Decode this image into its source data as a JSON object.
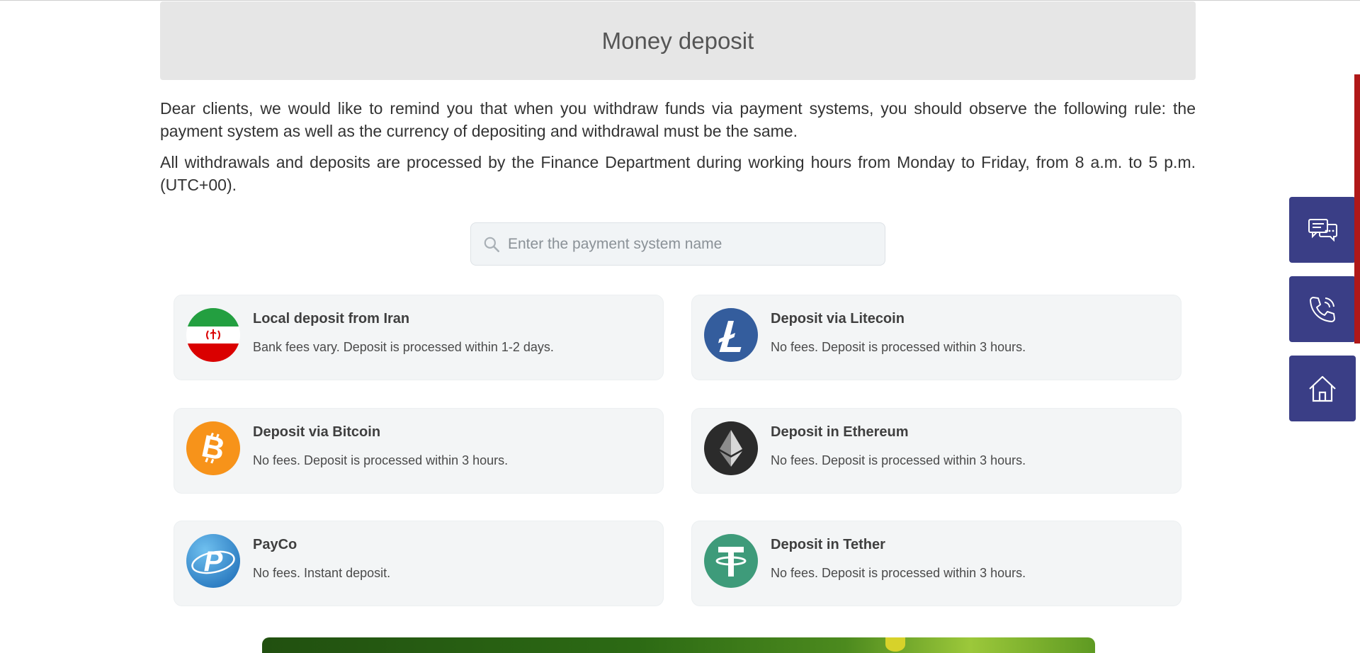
{
  "header": {
    "title": "Money deposit"
  },
  "notice": {
    "paragraph1": "Dear clients, we would like to remind you that when you withdraw funds via payment systems, you should observe the following rule: the payment system as well as the currency of depositing and withdrawal must be the same.",
    "paragraph2": "All withdrawals and deposits are processed by the Finance Department during working hours from Monday to Friday, from 8 a.m. to 5 p.m. (UTC+00)."
  },
  "search": {
    "placeholder": "Enter the payment system name",
    "value": "",
    "icon": "search-icon"
  },
  "payment_methods": [
    {
      "title": "Local deposit from Iran",
      "description": "Bank fees vary. Deposit is processed within 1-2 days.",
      "icon": "iran-flag-icon"
    },
    {
      "title": "Deposit via Litecoin",
      "description": "No fees. Deposit is processed within 3 hours.",
      "icon": "litecoin-icon",
      "color": "#345d9d"
    },
    {
      "title": "Deposit via Bitcoin",
      "description": "No fees. Deposit is processed within 3 hours.",
      "icon": "bitcoin-icon",
      "color": "#f7931a"
    },
    {
      "title": "Deposit in Ethereum",
      "description": "No fees. Deposit is processed within 3 hours.",
      "icon": "ethereum-icon",
      "color": "#2b2b2b"
    },
    {
      "title": "PayCo",
      "description": "No fees. Instant deposit.",
      "icon": "payco-icon",
      "color": "#3b8fcf"
    },
    {
      "title": "Deposit in Tether",
      "description": "No fees. Deposit is processed within 3 hours.",
      "icon": "tether-icon",
      "color": "#3e9b7a"
    }
  ],
  "side_buttons": [
    {
      "icon": "chat-icon"
    },
    {
      "icon": "phone-icon"
    },
    {
      "icon": "home-icon"
    }
  ],
  "colors": {
    "header_bg": "#e6e6e6",
    "card_bg": "#f3f5f6",
    "side_button_bg": "#3a3e86",
    "scroll_accent": "#b01818"
  }
}
